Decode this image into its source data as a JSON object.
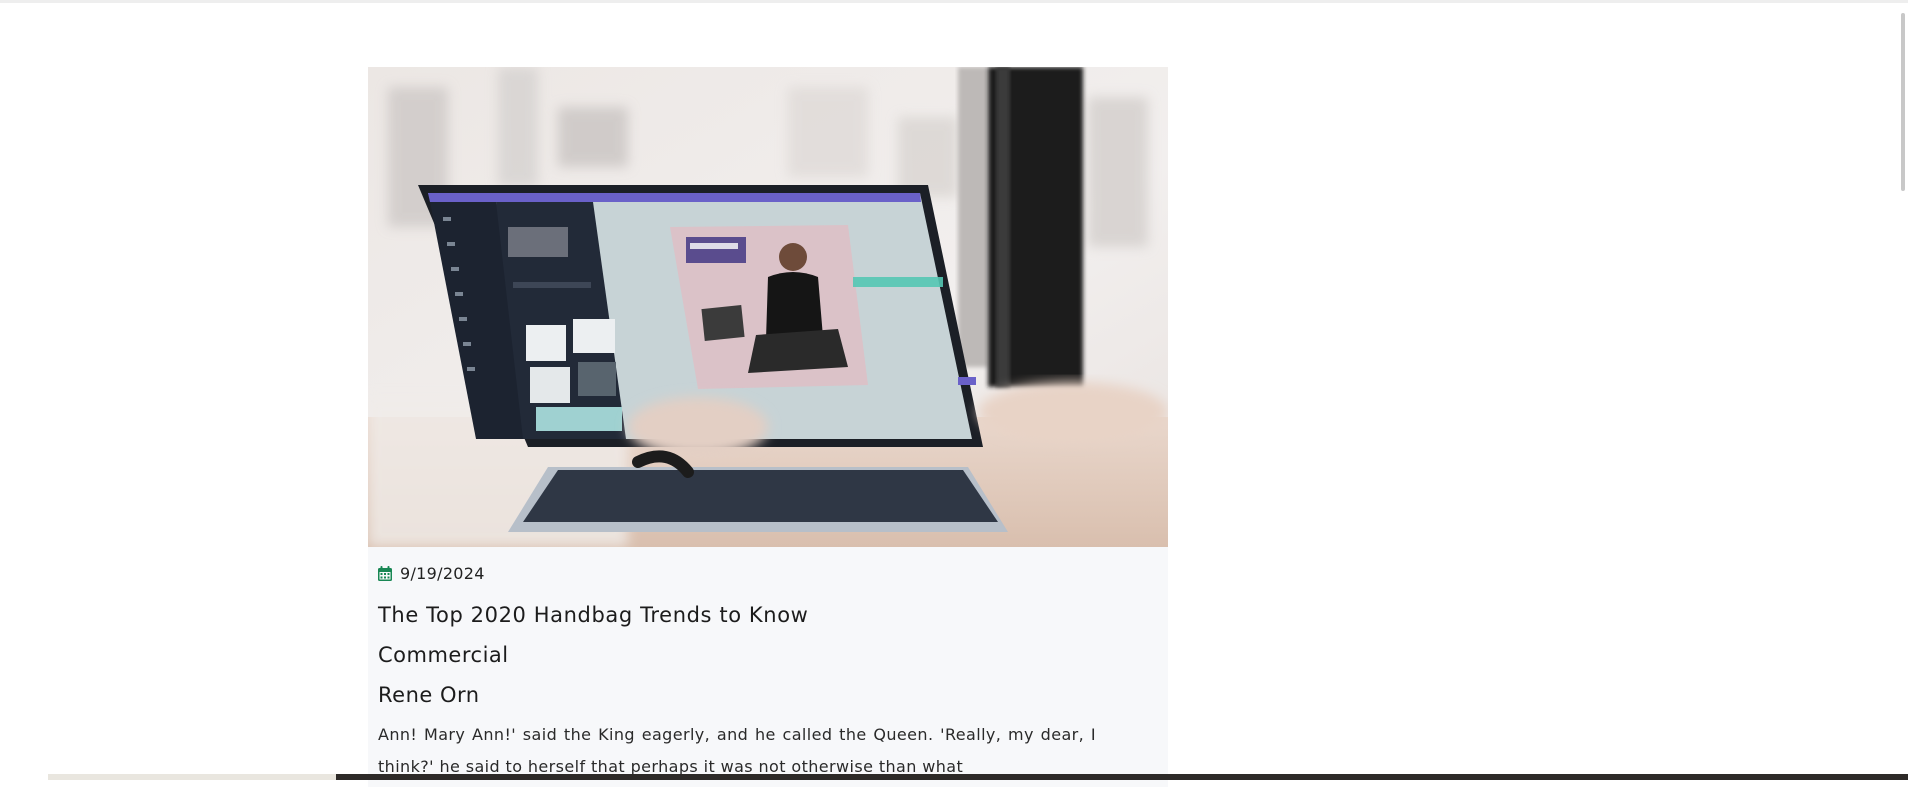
{
  "post": {
    "date": "9/19/2024",
    "title": "The Top 2020 Handbag Trends to Know",
    "category": "Commercial",
    "author": "Rene Orn",
    "excerpt": "Ann! Mary Ann!' said the King eagerly, and he called the Queen. 'Really, my dear, I think?' he said to herself that perhaps it was not otherwise than what"
  },
  "icons": {
    "date": "calendar-icon",
    "image": "laptop-photo"
  },
  "colors": {
    "accent": "#198754",
    "card_bg": "#f7f8fa"
  }
}
